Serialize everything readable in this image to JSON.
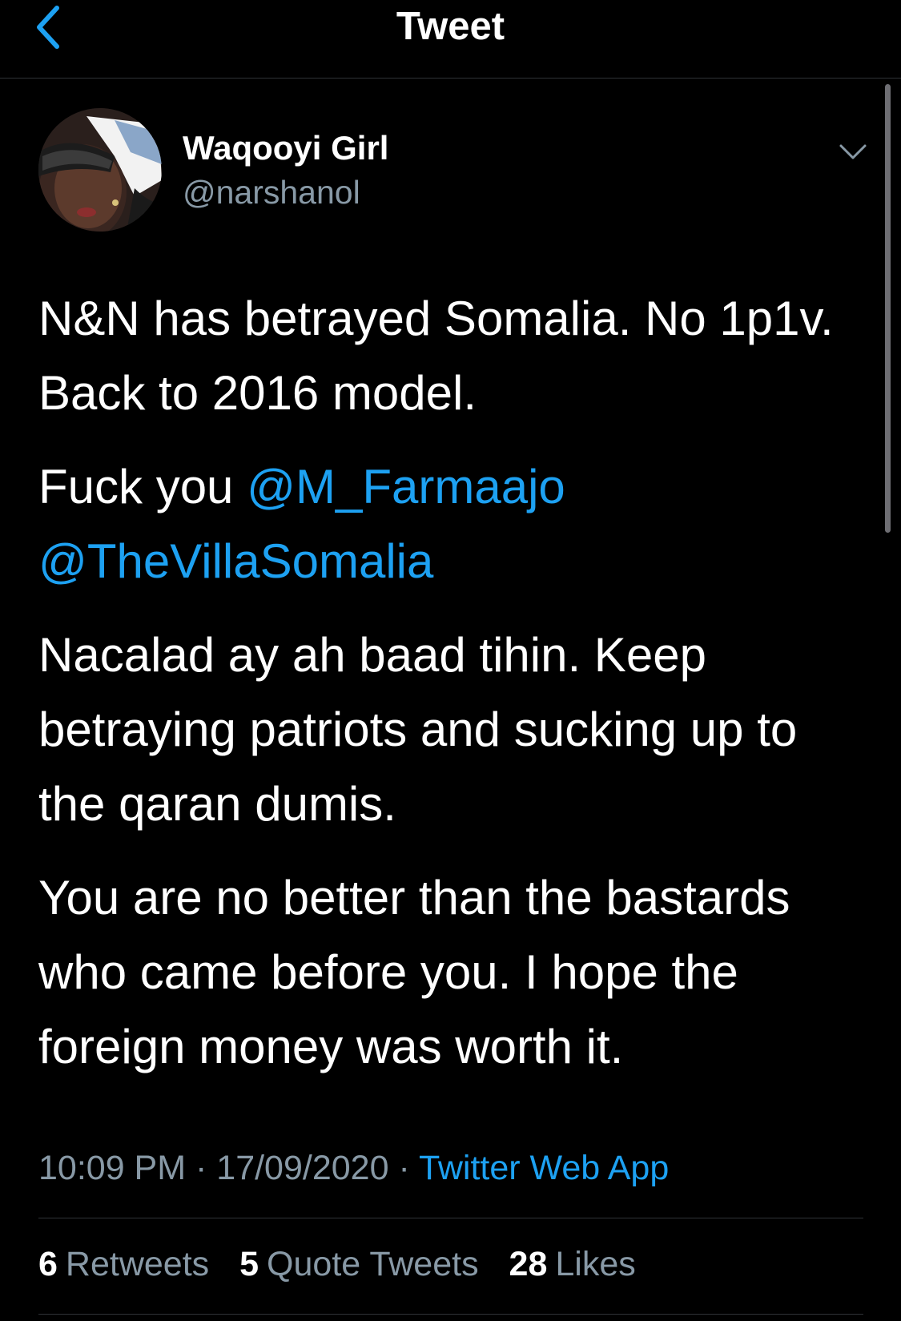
{
  "header": {
    "title": "Tweet",
    "back_icon": "chevron-left-icon",
    "back_color": "#1da1f2"
  },
  "author": {
    "display_name": "Waqooyi Girl",
    "handle": "@narshanol",
    "avatar_icon": "avatar-illustration",
    "more_icon": "chevron-down-icon"
  },
  "tweet": {
    "p1": "N&N has betrayed Somalia. No 1p1v. Back to 2016 model.",
    "p2_prefix": "Fuck you ",
    "mention1": "@M_Farmaajo",
    "mention2": "@TheVillaSomalia",
    "p3": "Nacalad ay ah baad tihin. Keep betraying patriots and sucking up to the qaran dumis.",
    "p4": "You are no better than the bastards who came before you. I hope the foreign money was worth it."
  },
  "meta": {
    "time": "10:09 PM",
    "sep1": " · ",
    "date": "17/09/2020",
    "sep2": " · ",
    "source": "Twitter Web App"
  },
  "stats": {
    "retweets_count": "6",
    "retweets_label": "Retweets",
    "quotes_count": "5",
    "quotes_label": "Quote Tweets",
    "likes_count": "28",
    "likes_label": "Likes"
  },
  "colors": {
    "background": "#000000",
    "accent": "#1da1f2",
    "secondary_text": "#8899a6",
    "divider": "#2f3336"
  }
}
